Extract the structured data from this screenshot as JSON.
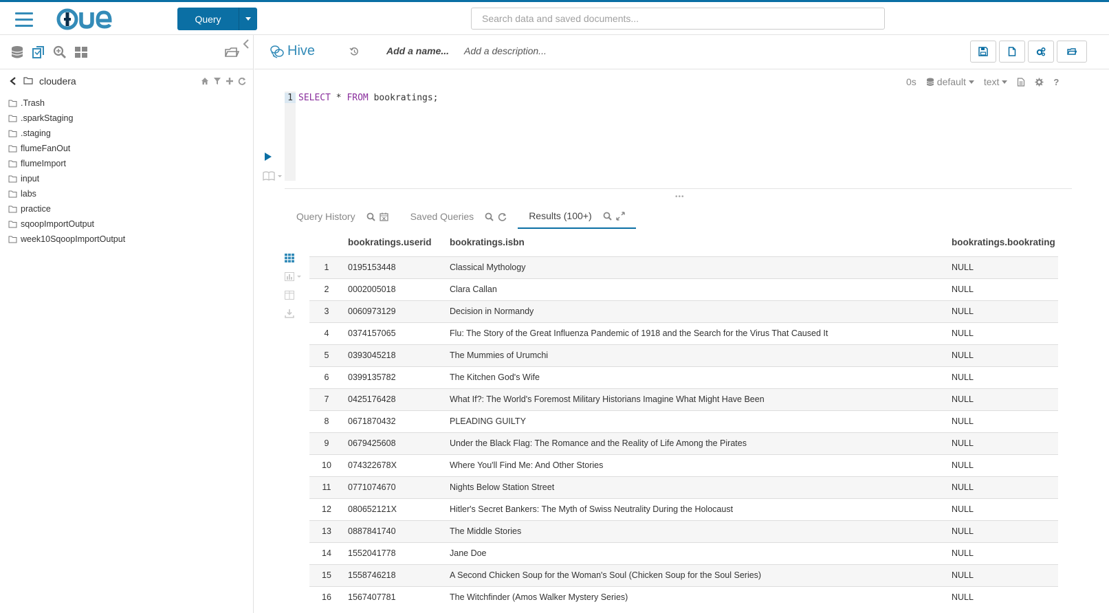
{
  "nav": {
    "query_label": "Query",
    "search_placeholder": "Search data and saved documents..."
  },
  "assist": {
    "path_name": "cloudera",
    "items": [
      ".Trash",
      ".sparkStaging",
      ".staging",
      "flumeFanOut",
      "flumeImport",
      "input",
      "labs",
      "practice",
      "sqoopImportOutput",
      "week10SqoopImportOutput"
    ]
  },
  "editor": {
    "type": "Hive",
    "name_placeholder": "Add a name...",
    "desc_placeholder": "Add a description...",
    "line_number": "1",
    "code_select": "SELECT",
    "code_star": " * ",
    "code_from": "FROM",
    "code_rest": " bookratings;",
    "exec_time": "0s",
    "database": "default",
    "format": "text"
  },
  "tabs": {
    "history": "Query History",
    "saved": "Saved Queries",
    "results": "Results (100+)"
  },
  "results": {
    "columns": [
      "bookratings.userid",
      "bookratings.isbn",
      "bookratings.bookrating"
    ],
    "rows": [
      [
        "1",
        "0195153448",
        "Classical Mythology",
        "NULL"
      ],
      [
        "2",
        "0002005018",
        "Clara Callan",
        "NULL"
      ],
      [
        "3",
        "0060973129",
        "Decision in Normandy",
        "NULL"
      ],
      [
        "4",
        "0374157065",
        "Flu: The Story of the Great Influenza Pandemic of 1918 and the Search for the Virus That Caused It",
        "NULL"
      ],
      [
        "5",
        "0393045218",
        "The Mummies of Urumchi",
        "NULL"
      ],
      [
        "6",
        "0399135782",
        "The Kitchen God's Wife",
        "NULL"
      ],
      [
        "7",
        "0425176428",
        "What If?: The World's Foremost Military Historians Imagine What Might Have Been",
        "NULL"
      ],
      [
        "8",
        "0671870432",
        "PLEADING GUILTY",
        "NULL"
      ],
      [
        "9",
        "0679425608",
        "Under the Black Flag: The Romance and the Reality of Life Among the Pirates",
        "NULL"
      ],
      [
        "10",
        "074322678X",
        "Where You'll Find Me: And Other Stories",
        "NULL"
      ],
      [
        "11",
        "0771074670",
        "Nights Below Station Street",
        "NULL"
      ],
      [
        "12",
        "080652121X",
        "Hitler's Secret Bankers: The Myth of Swiss Neutrality During the Holocaust",
        "NULL"
      ],
      [
        "13",
        "0887841740",
        "The Middle Stories",
        "NULL"
      ],
      [
        "14",
        "1552041778",
        "Jane Doe",
        "NULL"
      ],
      [
        "15",
        "1558746218",
        "A Second Chicken Soup for the Woman's Soul (Chicken Soup for the Soul Series)",
        "NULL"
      ],
      [
        "16",
        "1567407781",
        "The Witchfinder (Amos Walker Mystery Series)",
        "NULL"
      ]
    ]
  },
  "colors": {
    "primary": "#0b6fa4",
    "accent": "#338bb8"
  }
}
